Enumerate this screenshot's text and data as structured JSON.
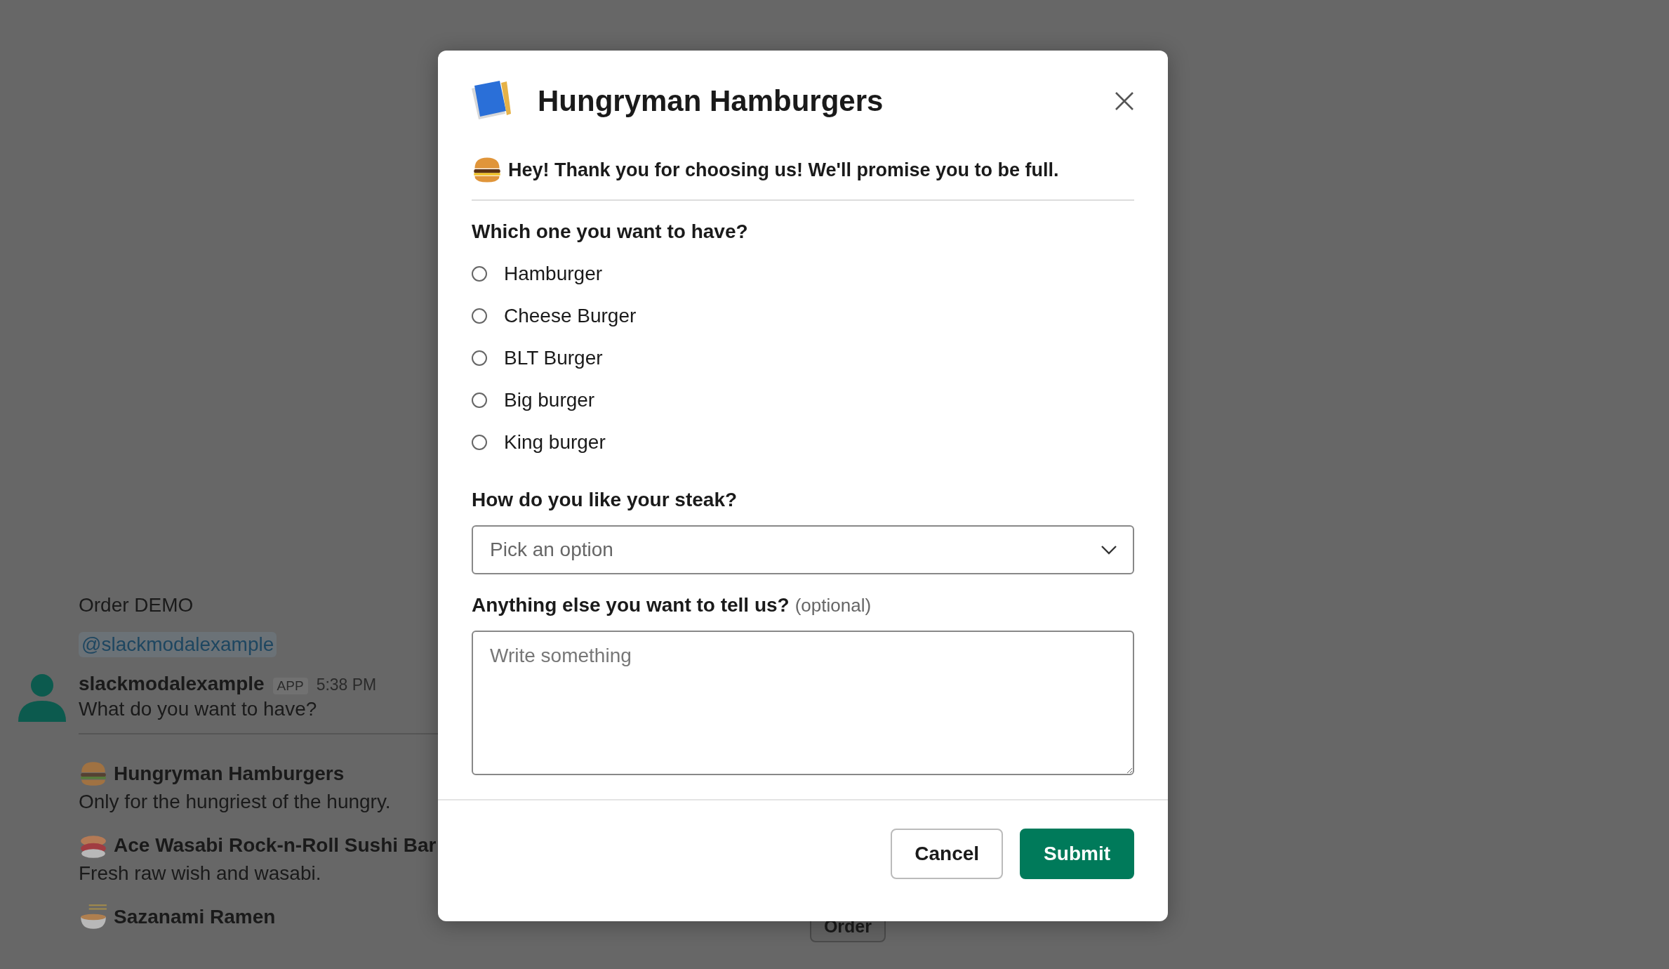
{
  "background": {
    "channel_title": "Order DEMO",
    "mention": "@slackmodalexample",
    "message": {
      "author": "slackmodalexample",
      "badge": "APP",
      "time": "5:38 PM",
      "text": "What do you want to have?"
    },
    "restaurants": [
      {
        "kind": "burger",
        "name": "Hungryman Hamburgers",
        "description": "Only for the hungriest of the hungry."
      },
      {
        "kind": "sushi",
        "name": "Ace Wasabi Rock-n-Roll Sushi Bar",
        "description": "Fresh raw wish and wasabi."
      },
      {
        "kind": "ramen",
        "name": "Sazanami Ramen",
        "action": "Order"
      }
    ]
  },
  "modal": {
    "title": "Hungryman Hamburgers",
    "intro": "Hey! Thank you for choosing us! We'll promise you to be full.",
    "question": "Which one you want to have?",
    "options": [
      {
        "label": "Hamburger",
        "selected": false
      },
      {
        "label": "Cheese Burger",
        "selected": false
      },
      {
        "label": "BLT Burger",
        "selected": false
      },
      {
        "label": "Big burger",
        "selected": false
      },
      {
        "label": "King burger",
        "selected": false
      }
    ],
    "select": {
      "label": "How do you like your steak?",
      "placeholder": "Pick an option"
    },
    "notes": {
      "label": "Anything else you want to tell us?",
      "hint": "(optional)",
      "placeholder": "Write something"
    },
    "buttons": [
      {
        "kind": "secondary",
        "label": "Cancel"
      },
      {
        "kind": "primary",
        "label": "Submit"
      }
    ]
  }
}
